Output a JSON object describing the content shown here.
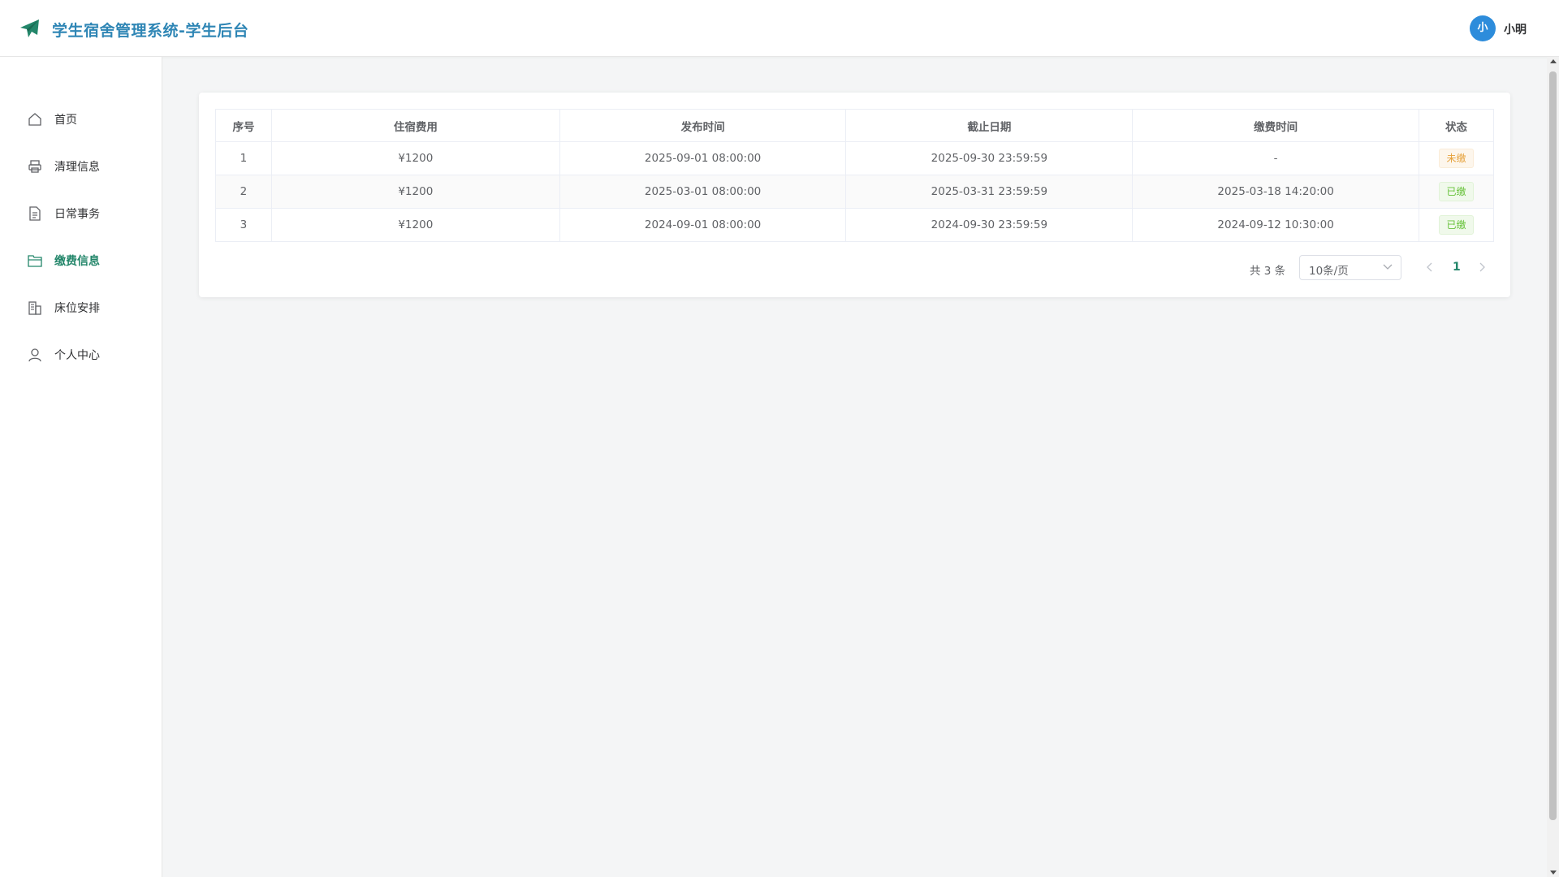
{
  "header": {
    "title": "学生宿舍管理系统-学生后台",
    "avatar_text": "小",
    "username": "小明",
    "accent_color": "#2f86b5",
    "logo_icon": "paper-plane-icon"
  },
  "sidebar": {
    "active_color": "#23866a",
    "items": [
      {
        "label": "首页",
        "icon": "home-icon"
      },
      {
        "label": "清理信息",
        "icon": "printer-icon"
      },
      {
        "label": "日常事务",
        "icon": "document-icon"
      },
      {
        "label": "缴费信息",
        "icon": "folder-icon",
        "active": true
      },
      {
        "label": "床位安排",
        "icon": "building-icon"
      },
      {
        "label": "个人中心",
        "icon": "user-icon"
      }
    ]
  },
  "table": {
    "columns": [
      "序号",
      "住宿费用",
      "发布时间",
      "截止日期",
      "缴费时间",
      "状态"
    ],
    "rows": [
      {
        "index": "1",
        "fee": "¥1200",
        "published": "2025-09-01 08:00:00",
        "deadline": "2025-09-30 23:59:59",
        "paid_time": "-",
        "status": "未缴"
      },
      {
        "index": "2",
        "fee": "¥1200",
        "published": "2025-03-01 08:00:00",
        "deadline": "2025-03-31 23:59:59",
        "paid_time": "2025-03-18 14:20:00",
        "status": "已缴"
      },
      {
        "index": "3",
        "fee": "¥1200",
        "published": "2024-09-01 08:00:00",
        "deadline": "2024-09-30 23:59:59",
        "paid_time": "2024-09-12 10:30:00",
        "status": "已缴"
      }
    ]
  },
  "pagination": {
    "total": "共 3 条",
    "page_size": "10条/页",
    "current_page": "1"
  }
}
